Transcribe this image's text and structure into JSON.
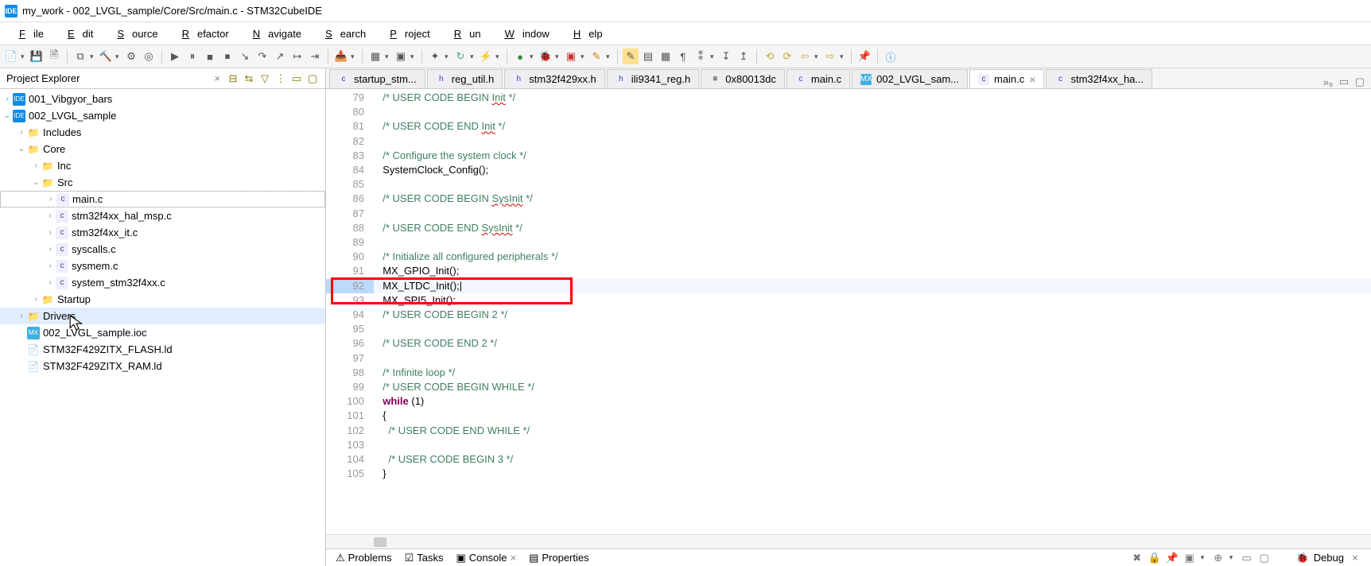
{
  "title": "my_work - 002_LVGL_sample/Core/Src/main.c - STM32CubeIDE",
  "menu": {
    "items": [
      "File",
      "Edit",
      "Source",
      "Refactor",
      "Navigate",
      "Search",
      "Project",
      "Run",
      "Window",
      "Help"
    ]
  },
  "project_explorer": {
    "title": "Project Explorer",
    "tree": [
      {
        "indent": 0,
        "twist": ">",
        "icon": "ide",
        "label": "001_Vibgyor_bars"
      },
      {
        "indent": 0,
        "twist": "v",
        "icon": "ide",
        "label": "002_LVGL_sample"
      },
      {
        "indent": 1,
        "twist": ">",
        "icon": "folder",
        "label": "Includes"
      },
      {
        "indent": 1,
        "twist": "v",
        "icon": "folder",
        "label": "Core"
      },
      {
        "indent": 2,
        "twist": ">",
        "icon": "folder",
        "label": "Inc"
      },
      {
        "indent": 2,
        "twist": "v",
        "icon": "folder",
        "label": "Src"
      },
      {
        "indent": 3,
        "twist": ">",
        "icon": "c",
        "label": "main.c",
        "sel": true
      },
      {
        "indent": 3,
        "twist": ">",
        "icon": "c",
        "label": "stm32f4xx_hal_msp.c"
      },
      {
        "indent": 3,
        "twist": ">",
        "icon": "c",
        "label": "stm32f4xx_it.c"
      },
      {
        "indent": 3,
        "twist": ">",
        "icon": "c",
        "label": "syscalls.c"
      },
      {
        "indent": 3,
        "twist": ">",
        "icon": "c",
        "label": "sysmem.c"
      },
      {
        "indent": 3,
        "twist": ">",
        "icon": "c",
        "label": "system_stm32f4xx.c"
      },
      {
        "indent": 2,
        "twist": ">",
        "icon": "folder",
        "label": "Startup"
      },
      {
        "indent": 1,
        "twist": ">",
        "icon": "folder",
        "label": "Drivers",
        "sel_drv": true
      },
      {
        "indent": 1,
        "twist": "",
        "icon": "mx",
        "label": "002_LVGL_sample.ioc"
      },
      {
        "indent": 1,
        "twist": "",
        "icon": "file",
        "label": "STM32F429ZITX_FLASH.ld"
      },
      {
        "indent": 1,
        "twist": "",
        "icon": "file",
        "label": "STM32F429ZITX_RAM.ld"
      }
    ]
  },
  "tabs": [
    {
      "icon": "c",
      "label": "startup_stm...",
      "close": false
    },
    {
      "icon": "h",
      "label": "reg_util.h",
      "close": false
    },
    {
      "icon": "h",
      "label": "stm32f429xx.h",
      "close": false
    },
    {
      "icon": "h",
      "label": "ili9341_reg.h",
      "close": false
    },
    {
      "icon": "hex",
      "label": "0x80013dc",
      "close": false
    },
    {
      "icon": "c",
      "label": "main.c",
      "close": false
    },
    {
      "icon": "mx",
      "label": "002_LVGL_sam...",
      "close": false
    },
    {
      "icon": "c",
      "label": "main.c",
      "close": true,
      "active": true
    },
    {
      "icon": "c",
      "label": "stm32f4xx_ha...",
      "close": false
    }
  ],
  "code": [
    {
      "n": 79,
      "text": "  /* USER CODE BEGIN Init */",
      "c": true,
      "wavy": "Init"
    },
    {
      "n": 80,
      "text": ""
    },
    {
      "n": 81,
      "text": "  /* USER CODE END Init */",
      "c": true,
      "wavy": "Init"
    },
    {
      "n": 82,
      "text": ""
    },
    {
      "n": 83,
      "text": "  /* Configure the system clock */",
      "c": true
    },
    {
      "n": 84,
      "text": "  SystemClock_Config();"
    },
    {
      "n": 85,
      "text": ""
    },
    {
      "n": 86,
      "text": "  /* USER CODE BEGIN SysInit */",
      "c": true,
      "wavy": "SysInit"
    },
    {
      "n": 87,
      "text": ""
    },
    {
      "n": 88,
      "text": "  /* USER CODE END SysInit */",
      "c": true,
      "wavy": "SysInit"
    },
    {
      "n": 89,
      "text": ""
    },
    {
      "n": 90,
      "text": "  /* Initialize all configured peripherals */",
      "c": true
    },
    {
      "n": 91,
      "text": "  MX_GPIO_Init();"
    },
    {
      "n": 92,
      "text": "  MX_LTDC_Init();",
      "caret": true
    },
    {
      "n": 93,
      "text": "  MX_SPI5_Init();"
    },
    {
      "n": 94,
      "text": "  /* USER CODE BEGIN 2 */",
      "c": true
    },
    {
      "n": 95,
      "text": ""
    },
    {
      "n": 96,
      "text": "  /* USER CODE END 2 */",
      "c": true
    },
    {
      "n": 97,
      "text": ""
    },
    {
      "n": 98,
      "text": "  /* Infinite loop */",
      "c": true
    },
    {
      "n": 99,
      "text": "  /* USER CODE BEGIN WHILE */",
      "c": true
    },
    {
      "n": 100,
      "kw": "while",
      "rest": " (1)"
    },
    {
      "n": 101,
      "text": "  {"
    },
    {
      "n": 102,
      "text": "    /* USER CODE END WHILE */",
      "c": true
    },
    {
      "n": 103,
      "text": ""
    },
    {
      "n": 104,
      "text": "    /* USER CODE BEGIN 3 */",
      "c": true
    },
    {
      "n": 105,
      "text": "  }"
    }
  ],
  "bottom_tabs": {
    "problems": "Problems",
    "tasks": "Tasks",
    "console": "Console",
    "properties": "Properties",
    "debug": "Debug"
  }
}
